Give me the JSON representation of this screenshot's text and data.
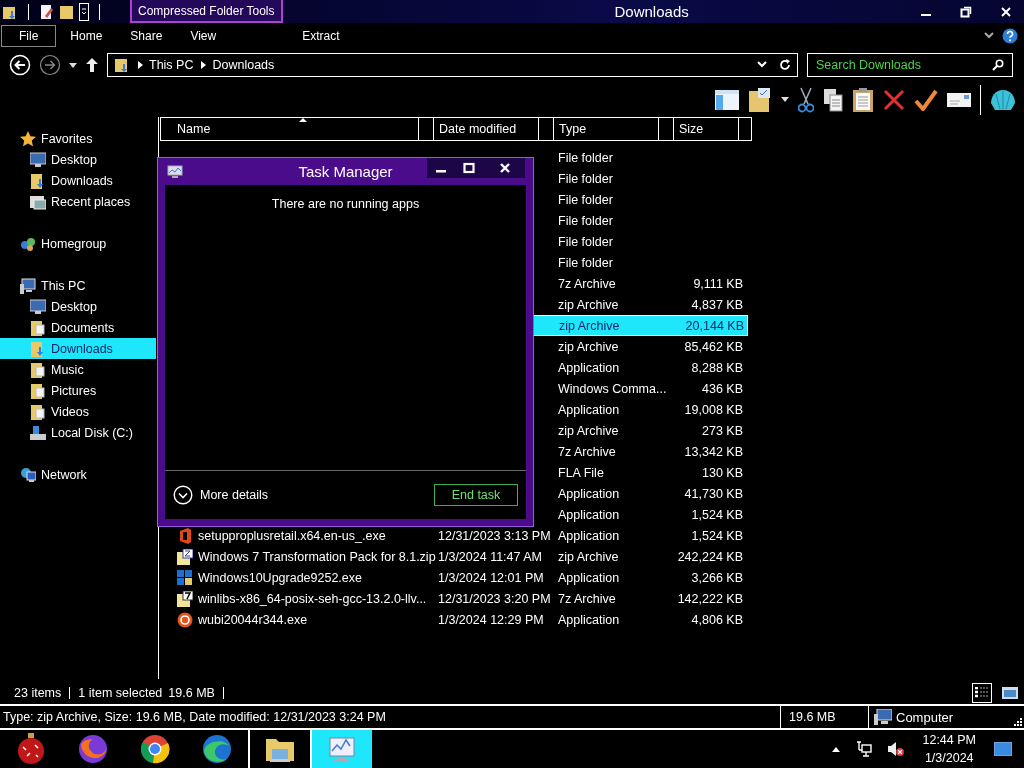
{
  "title_bar": {
    "contextual_tab": "Compressed Folder Tools",
    "title": "Downloads"
  },
  "ribbon_tabs": [
    {
      "label": "File",
      "kind": "file"
    },
    {
      "label": "Home",
      "kind": "tab"
    },
    {
      "label": "Share",
      "kind": "tab"
    },
    {
      "label": "View",
      "kind": "tab"
    },
    {
      "label": "Extract",
      "kind": "contextual"
    }
  ],
  "address": {
    "path": [
      "This PC",
      "Downloads"
    ]
  },
  "search": {
    "placeholder": "Search Downloads"
  },
  "navigation": [
    {
      "label": "Favorites",
      "kind": "star",
      "selected": false,
      "children": [
        {
          "label": "Desktop",
          "kind": "desktop",
          "selected": false
        },
        {
          "label": "Downloads",
          "kind": "downloads",
          "selected": false
        },
        {
          "label": "Recent places",
          "kind": "recent",
          "selected": false
        }
      ]
    },
    {
      "label": "Homegroup",
      "kind": "homegroup",
      "selected": false
    },
    {
      "label": "This PC",
      "kind": "pc",
      "selected": false,
      "children": [
        {
          "label": "Desktop",
          "kind": "desktop",
          "selected": false
        },
        {
          "label": "Documents",
          "kind": "folder",
          "selected": false
        },
        {
          "label": "Downloads",
          "kind": "downloads",
          "selected": true
        },
        {
          "label": "Music",
          "kind": "folder",
          "selected": false
        },
        {
          "label": "Pictures",
          "kind": "folder",
          "selected": false
        },
        {
          "label": "Videos",
          "kind": "folder",
          "selected": false
        },
        {
          "label": "Local Disk (C:)",
          "kind": "disk",
          "selected": false
        }
      ]
    },
    {
      "label": "Network",
      "kind": "network",
      "selected": false
    }
  ],
  "file_list": {
    "columns": [
      {
        "label": "Name",
        "sorted": true
      },
      {
        "label": "Date modified",
        "sorted": false
      },
      {
        "label": "Type",
        "sorted": false
      },
      {
        "label": "Size",
        "sorted": false
      }
    ],
    "rows": [
      {
        "type": "File folder",
        "selected": false
      },
      {
        "type": "File folder",
        "selected": false
      },
      {
        "type": "File folder",
        "selected": false
      },
      {
        "type": "File folder",
        "selected": false
      },
      {
        "type": "File folder",
        "selected": false
      },
      {
        "type": "File folder",
        "selected": false
      },
      {
        "type": "7z Archive",
        "size": "9,111 KB",
        "selected": false
      },
      {
        "type": "zip Archive",
        "size": "4,837 KB",
        "selected": false
      },
      {
        "type": "zip Archive",
        "size": "20,144 KB",
        "selected": true
      },
      {
        "type": "zip Archive",
        "size": "85,462 KB",
        "selected": false
      },
      {
        "type": "Application",
        "size": "8,288 KB",
        "selected": false
      },
      {
        "type": "Windows Comma...",
        "size": "436 KB",
        "selected": false
      },
      {
        "type": "Application",
        "size": "19,008 KB",
        "selected": false
      },
      {
        "type": "zip Archive",
        "size": "273 KB",
        "selected": false
      },
      {
        "type": "7z Archive",
        "size": "13,342 KB",
        "selected": false
      },
      {
        "type": "FLA File",
        "size": "130 KB",
        "selected": false
      },
      {
        "type": "Application",
        "size": "41,730 KB",
        "selected": false
      },
      {
        "type": "Application",
        "size": "1,524 KB",
        "selected": false
      },
      {
        "kind": "office",
        "name": "setupproplusretail.x64.en-us_.exe",
        "date": "12/31/2023 3:13 PM",
        "type": "Application",
        "size": "1,524 KB",
        "selected": false
      },
      {
        "kind": "zip",
        "name": "Windows 7 Transformation Pack for 8.1.zip",
        "date": "1/3/2024 11:47 AM",
        "type": "zip Archive",
        "size": "242,224 KB",
        "selected": false
      },
      {
        "kind": "windows",
        "name": "Windows10Upgrade9252.exe",
        "date": "1/3/2024 12:01 PM",
        "type": "Application",
        "size": "3,266 KB",
        "selected": false
      },
      {
        "kind": "sevenzip",
        "name": "winlibs-x86_64-posix-seh-gcc-13.2.0-llv...",
        "date": "12/31/2023 3:20 PM",
        "type": "7z Archive",
        "size": "142,222 KB",
        "selected": false
      },
      {
        "kind": "ubuntu",
        "name": "wubi20044r344.exe",
        "date": "1/3/2024 12:29 PM",
        "type": "Application",
        "size": "4,806 KB",
        "selected": false
      }
    ]
  },
  "views": [
    {
      "kind": "details",
      "selected": true
    },
    {
      "kind": "tiles",
      "selected": false
    }
  ],
  "status_bar": {
    "item_count": "23 items",
    "selection": "1 item selected",
    "selection_size": "19.6 MB"
  },
  "details_bar": {
    "description": "Type: zip Archive, Size: 19.6 MB, Date modified: 12/31/2023 3:24 PM",
    "size": "19.6 MB",
    "location": "Computer"
  },
  "task_manager": {
    "title": "Task Manager",
    "message": "There are no running apps",
    "more_details": "More details",
    "end_task": "End task"
  },
  "taskbar": {
    "apps": [
      {
        "kind": "ornament",
        "active": false
      },
      {
        "kind": "fox",
        "active": false
      },
      {
        "kind": "chrome",
        "active": false
      },
      {
        "kind": "edge",
        "active": false
      },
      {
        "kind": "explorer",
        "active": false
      },
      {
        "kind": "taskmgr",
        "active": true
      }
    ],
    "clock": {
      "time": "12:44 PM",
      "date": "1/3/2024"
    }
  }
}
